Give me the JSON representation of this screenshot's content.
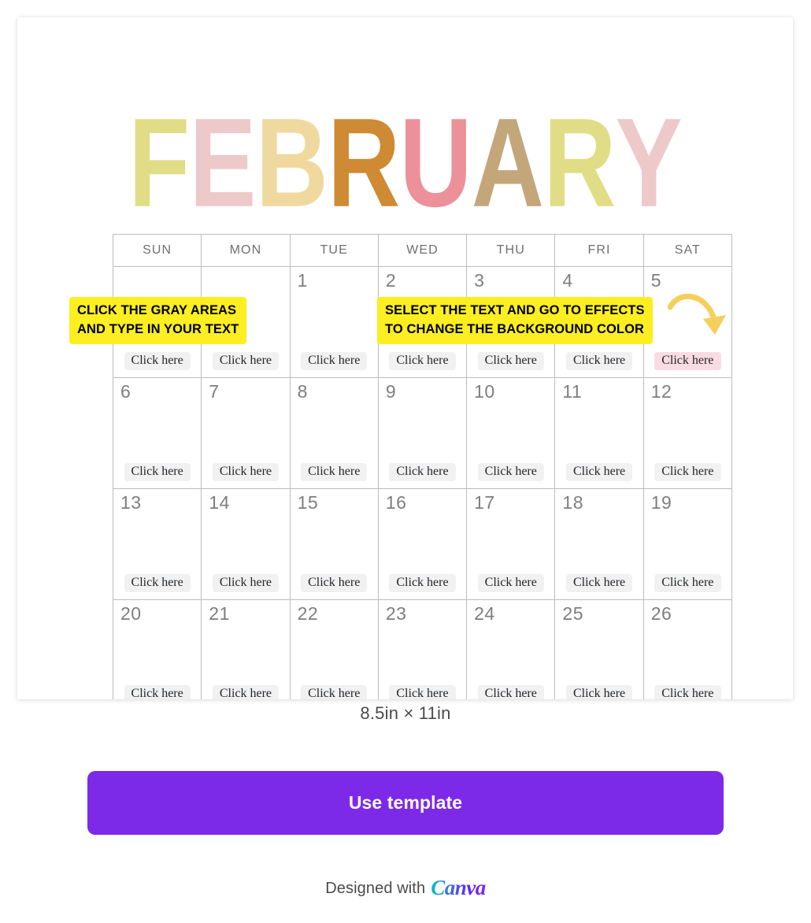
{
  "card": {
    "month_title": {
      "text": "FEBRUARY",
      "letters": [
        {
          "ch": "F",
          "color": "#e0dd86"
        },
        {
          "ch": "E",
          "color": "#eec9c9"
        },
        {
          "ch": "B",
          "color": "#f0d99e"
        },
        {
          "ch": "R",
          "color": "#ce8b34"
        },
        {
          "ch": "U",
          "color": "#ec9199"
        },
        {
          "ch": "A",
          "color": "#c3a67a"
        },
        {
          "ch": "R",
          "color": "#e0dd86"
        },
        {
          "ch": "Y",
          "color": "#eec9c9"
        }
      ]
    },
    "calendar": {
      "weekday_headers": [
        "SUN",
        "MON",
        "TUE",
        "WED",
        "THU",
        "FRI",
        "SAT"
      ],
      "cell_label": "Click here",
      "weeks": [
        [
          {
            "date": "",
            "label": "Click here",
            "highlight": false
          },
          {
            "date": "",
            "label": "Click here",
            "highlight": false
          },
          {
            "date": "1",
            "label": "Click here",
            "highlight": false
          },
          {
            "date": "2",
            "label": "Click here",
            "highlight": false
          },
          {
            "date": "3",
            "label": "Click here",
            "highlight": false
          },
          {
            "date": "4",
            "label": "Click here",
            "highlight": false
          },
          {
            "date": "5",
            "label": "Click here",
            "highlight": true
          }
        ],
        [
          {
            "date": "6",
            "label": "Click here",
            "highlight": false
          },
          {
            "date": "7",
            "label": "Click here",
            "highlight": false
          },
          {
            "date": "8",
            "label": "Click here",
            "highlight": false
          },
          {
            "date": "9",
            "label": "Click here",
            "highlight": false
          },
          {
            "date": "10",
            "label": "Click here",
            "highlight": false
          },
          {
            "date": "11",
            "label": "Click here",
            "highlight": false
          },
          {
            "date": "12",
            "label": "Click here",
            "highlight": false
          }
        ],
        [
          {
            "date": "13",
            "label": "Click here",
            "highlight": false
          },
          {
            "date": "14",
            "label": "Click here",
            "highlight": false
          },
          {
            "date": "15",
            "label": "Click here",
            "highlight": false
          },
          {
            "date": "16",
            "label": "Click here",
            "highlight": false
          },
          {
            "date": "17",
            "label": "Click here",
            "highlight": false
          },
          {
            "date": "18",
            "label": "Click here",
            "highlight": false
          },
          {
            "date": "19",
            "label": "Click here",
            "highlight": false
          }
        ],
        [
          {
            "date": "20",
            "label": "Click here",
            "highlight": false
          },
          {
            "date": "21",
            "label": "Click here",
            "highlight": false
          },
          {
            "date": "22",
            "label": "Click here",
            "highlight": false
          },
          {
            "date": "23",
            "label": "Click here",
            "highlight": false
          },
          {
            "date": "24",
            "label": "Click here",
            "highlight": false
          },
          {
            "date": "25",
            "label": "Click here",
            "highlight": false
          },
          {
            "date": "26",
            "label": "Click here",
            "highlight": false
          }
        ]
      ]
    },
    "annotations": [
      {
        "line1": "CLICK THE GRAY AREAS",
        "line2": "AND TYPE IN YOUR TEXT"
      },
      {
        "line1": "SELECT THE TEXT AND GO TO EFFECTS",
        "line2": "TO CHANGE THE BACKGROUND COLOR"
      }
    ]
  },
  "size_caption": "8.5in × 11in",
  "use_template_label": "Use template",
  "footer": {
    "prefix": "Designed with",
    "brand": "Canva"
  },
  "colors": {
    "accent_purple": "#7d2ae8",
    "note_yellow": "#fcee21",
    "arrow_gold": "#f5cf5c",
    "highlight_pink": "#f9dce3",
    "cell_gray": "#f1f1f1",
    "grid_line": "#bcbcbc"
  }
}
